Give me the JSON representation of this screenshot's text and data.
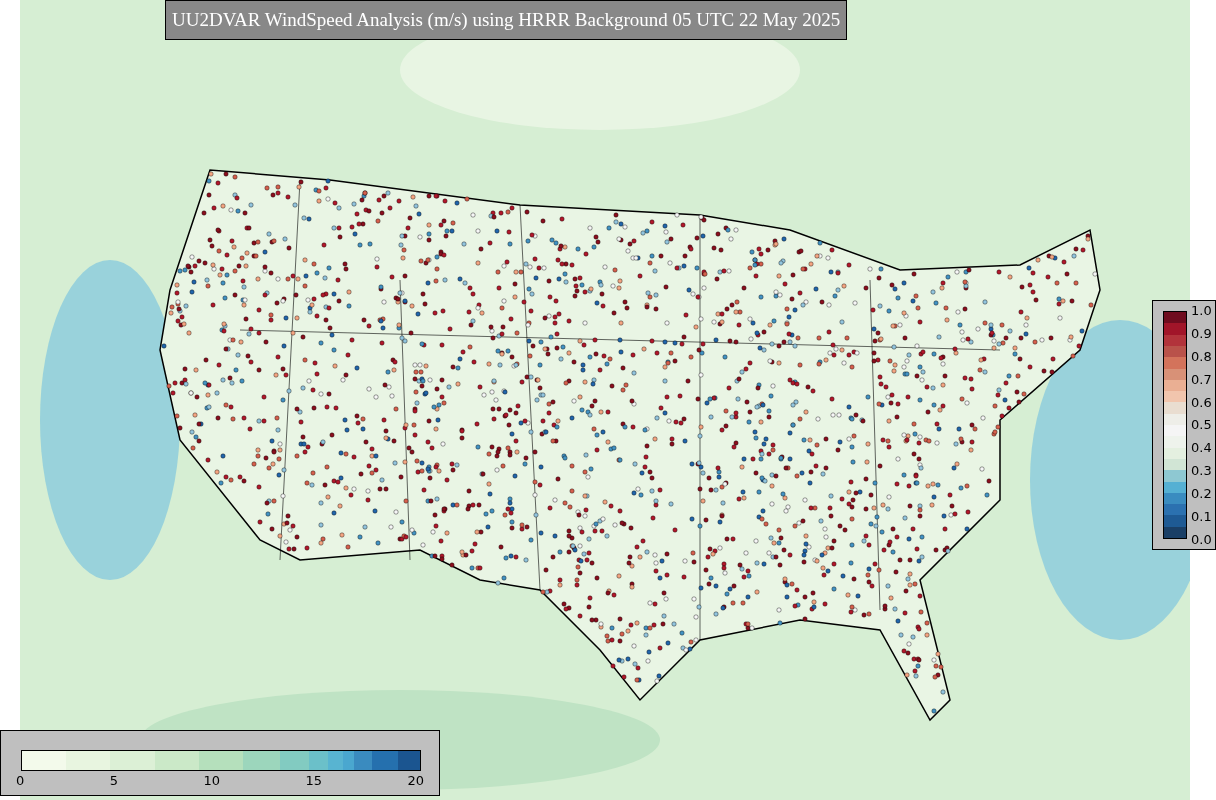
{
  "title": "UU2DVAR WindSpeed Analysis (m/s) using HRRR Background 05 UTC 22 May 2025",
  "ratio_colorbar": {
    "ticks": [
      "1.0",
      "0.9",
      "0.8",
      "0.7",
      "0.6",
      "0.5",
      "0.4",
      "0.3",
      "0.2",
      "0.1",
      "0.0"
    ]
  },
  "speed_colorbar": {
    "ticks": [
      "0",
      "5",
      "10",
      "15",
      "20"
    ]
  }
}
